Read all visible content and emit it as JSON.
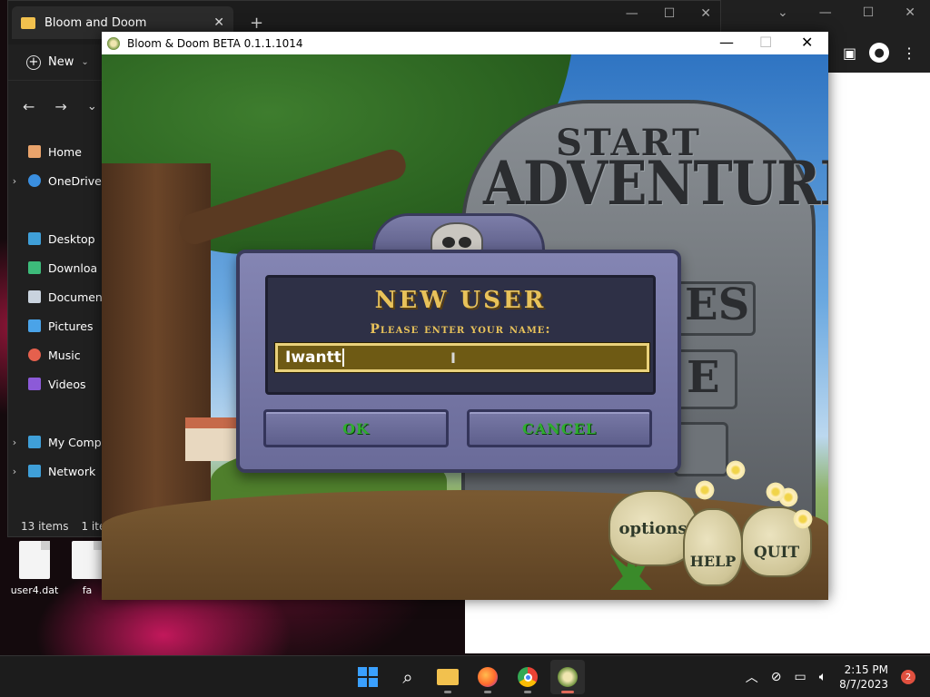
{
  "explorer": {
    "tab_title": "Bloom and Doom",
    "new_label": "New",
    "sidebar": [
      {
        "label": "Home"
      },
      {
        "label": "OneDrive"
      },
      {
        "label": "Desktop"
      },
      {
        "label": "Downloa"
      },
      {
        "label": "Documen"
      },
      {
        "label": "Pictures"
      },
      {
        "label": "Music"
      },
      {
        "label": "Videos"
      },
      {
        "label": "My Comp"
      },
      {
        "label": "Network"
      }
    ],
    "status_items": "13 items",
    "status_selected": "1 ite"
  },
  "desktop": {
    "icons": [
      {
        "label": "user4.dat"
      },
      {
        "label": "fa"
      }
    ]
  },
  "game": {
    "window_title": "Bloom & Doom BETA 0.1.1.1014",
    "sign_line1": "START",
    "sign_line2": "ADVENTURE",
    "slab1": "ES",
    "slab2": "E",
    "sacks": {
      "options": "options",
      "help": "HELP",
      "quit": "QUIT"
    },
    "dialog": {
      "title": "NEW USER",
      "prompt": "Please enter your name:",
      "name_value": "Iwantt",
      "ok_label": "OK",
      "cancel_label": "CANCEL"
    }
  },
  "taskbar": {
    "time": "2:15 PM",
    "date": "8/7/2023",
    "notification_count": "2"
  },
  "colors": {
    "dialog_gold": "#e8c25a",
    "button_green": "#2fae2f",
    "dialog_frame": "#6a6b99"
  }
}
